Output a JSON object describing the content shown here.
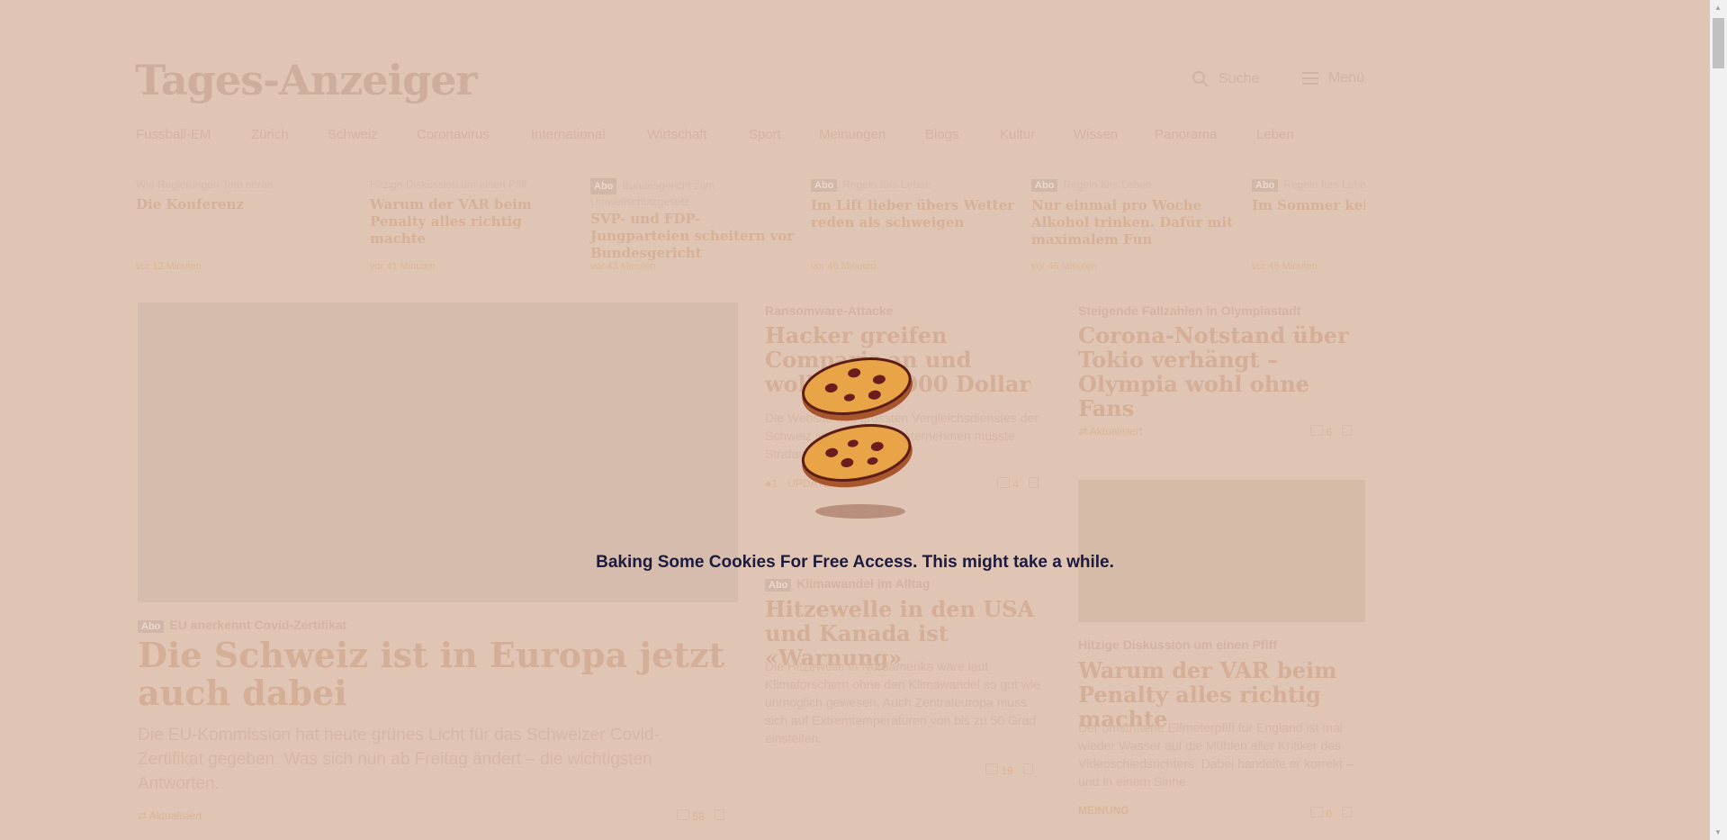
{
  "header": {
    "logo": "Tages-Anzeiger",
    "search_label": "Suche",
    "menu_label": "Menü"
  },
  "nav": [
    "Fussball-EM",
    "Zürich",
    "Schweiz",
    "Coronavirus",
    "International",
    "Wirtschaft",
    "Sport",
    "Meinungen",
    "Blogs",
    "Kultur",
    "Wissen",
    "Panorama",
    "Leben"
  ],
  "teasers": [
    {
      "kicker": "Wie Regierungen Tote ehren",
      "abo": false,
      "title": "Die Konferenz",
      "meta": "vor 12 Minuten"
    },
    {
      "kicker": "Hitzige Diskussion um einen Pfiff",
      "abo": false,
      "title": "Warum der VAR beim Penalty alles richtig machte",
      "meta": "vor 41 Minuten"
    },
    {
      "kicker": "Bundesgericht zum Umweltschutzgesetz",
      "abo": true,
      "title": "SVP- und FDP-Jungparteien scheitern vor Bundesgericht",
      "meta": "vor 43 Minuten"
    },
    {
      "kicker": "Regeln fürs Leben",
      "abo": true,
      "title": "Im Lift lieber übers Wetter reden als schweigen",
      "meta": "vor 45 Minuten"
    },
    {
      "kicker": "Regeln fürs Leben",
      "abo": true,
      "title": "Nur einmal pro Woche Alkohol trinken. Dafür mit maximalem Fun",
      "meta": "vor 45 Minuten"
    },
    {
      "kicker": "Regeln fürs Leben",
      "abo": true,
      "title": "Im Sommer kein fahren",
      "meta": "vor 45 Minuten"
    }
  ],
  "abo_label": "Abo",
  "main_article": {
    "kicker": "EU anerkennt Covid-Zertifikat",
    "title": "Die Schweiz ist in Europa jetzt auch dabei",
    "lead": "Die EU-Kommission hat heute grünes Licht für das Schweizer Covid-Zertifikat gegeben. Was sich nun ab Freitag ändert – die wichtigsten Antworten.",
    "meta": "Aktualisiert",
    "comments": "58"
  },
  "article_2": {
    "kicker": "Ransomware-Attacke",
    "title": "Hacker greifen Comparis an und wollen 400'000 Dollar",
    "lead": "Die Website des grössten Vergleichsdienstes der Schweiz ist down. Das Unternehmen musste Strafanzeige einreichen.",
    "meta": "UPDATE",
    "comments": "4"
  },
  "article_3": {
    "kicker": "Klimawandel im Alltag",
    "title": "Hitzewelle in den USA und Kanada ist «Warnung»",
    "lead": "Die Hitzewelle in Nordamerika wäre laut Klimaforschern ohne den Klimawandel so gut wie unmöglich gewesen. Auch Zentraleuropa muss sich auf Extremtemperaturen von bis zu 50 Grad einstellen.",
    "comments": "19"
  },
  "article_4": {
    "kicker": "Steigende Fallzahlen in Olympiastadt",
    "title": "Corona-Notstand über Tokio verhängt – Olympia wohl ohne Fans",
    "meta": "Aktualisiert",
    "comments": "6"
  },
  "article_5": {
    "kicker": "Hitzige Diskussion um einen Pfiff",
    "title": "Warum der VAR beim Penalty alles richtig machte",
    "lead": "Der umstrittene Elfmeterpfiff für England ist mal wieder Wasser auf die Mühlen aller Kritiker des Videoschiedsrichters. Dabei handelte er korrekt – und in einem Sinne.",
    "meta": "MEINUNG",
    "comments": "0"
  },
  "overlay": {
    "message": "Baking Some Cookies For Free Access. This might take a while."
  }
}
